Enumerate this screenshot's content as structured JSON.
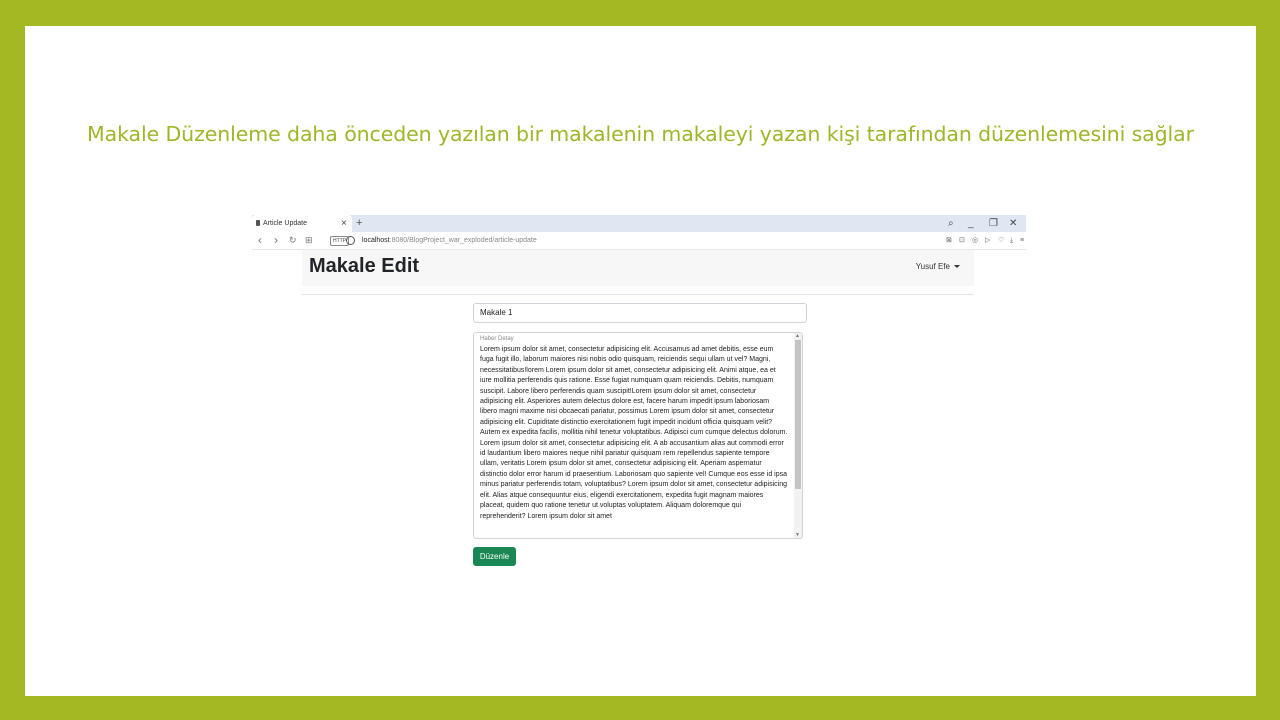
{
  "slide": {
    "title": "Makale Düzenleme daha önceden yazılan bir makalenin makaleyi yazan kişi tarafından düzenlemesini sağlar"
  },
  "browser": {
    "tab_title": "Article Update",
    "tab_close": "×",
    "new_tab": "+",
    "window_controls": {
      "search": "⌕",
      "minimize": "_",
      "restore": "❐",
      "close": "✕"
    },
    "nav": {
      "back": "‹",
      "forward": "›",
      "reload": "↻",
      "split": "⊞"
    },
    "http_badge": "HTTP",
    "url_host": "localhost",
    "url_rest": ":8080/BlogProject_war_exploded/article-update",
    "extensions": [
      "⊠",
      "⊡",
      "◎",
      "▷",
      "♡",
      "⤓",
      "≡"
    ]
  },
  "navbar": {
    "brand": "Makale Edit",
    "user": "Yusuf Efe"
  },
  "form": {
    "title_value": "Makale 1",
    "detail_label": "Haber Detay",
    "detail_value": "Lorem ipsum dolor sit amet, consectetur adipisicing elit. Accusamus ad amet debitis, esse eum fuga fugit illo, laborum maiores nisi nobis odio quisquam, reiciendis sequi ullam ut vel? Magni, necessitatibus!lorem  Lorem ipsum dolor sit amet, consectetur adipisicing elit. Animi atque, ea et iure mollitia perferendis quis ratione. Esse fugiat numquam quam reiciendis. Debitis, numquam suscipit. Labore libero perferendis quam suscipit!Lorem ipsum dolor sit amet, consectetur adipisicing elit. Asperiores autem delectus dolore est, facere harum impedit ipsum laboriosam libero magni maxime nisi obcaecati pariatur, possimus Lorem ipsum dolor sit amet, consectetur adipisicing elit. Cupiditate distinctio exercitationem fugit impedit incidunt officia quisquam velit? Autem ex expedita facilis, mollitia nihil tenetur voluptatibus. Adipisci cum cumque delectus dolorum. Lorem ipsum dolor sit amet, consectetur adipisicing elit. A ab accusantium alias aut commodi error id laudantium libero maiores neque nihil pariatur quisquam rem repellendus sapiente tempore ullam, veritatis Lorem ipsum dolor sit amet, consectetur adipisicing elit. Aperiam aspernatur distinctio dolor error harum id praesentium. Laboriosam quo sapiente vel! Cumque eos esse id ipsa minus pariatur perferendis totam, voluptatibus? Lorem ipsum dolor sit amet, consectetur adipisicing elit. Alias atque consequuntur eius, eligendi exercitationem, expedita fugit magnam maiores placeat, quidem quo ratione tenetur ut voluptas voluptatem. Aliquam doloremque qui reprehenderit? Lorem ipsum dolor sit amet",
    "submit_label": "Düzenle"
  },
  "colors": {
    "slide_frame": "#a4b823",
    "slide_title": "#a0b52a",
    "submit_button": "#198754"
  }
}
